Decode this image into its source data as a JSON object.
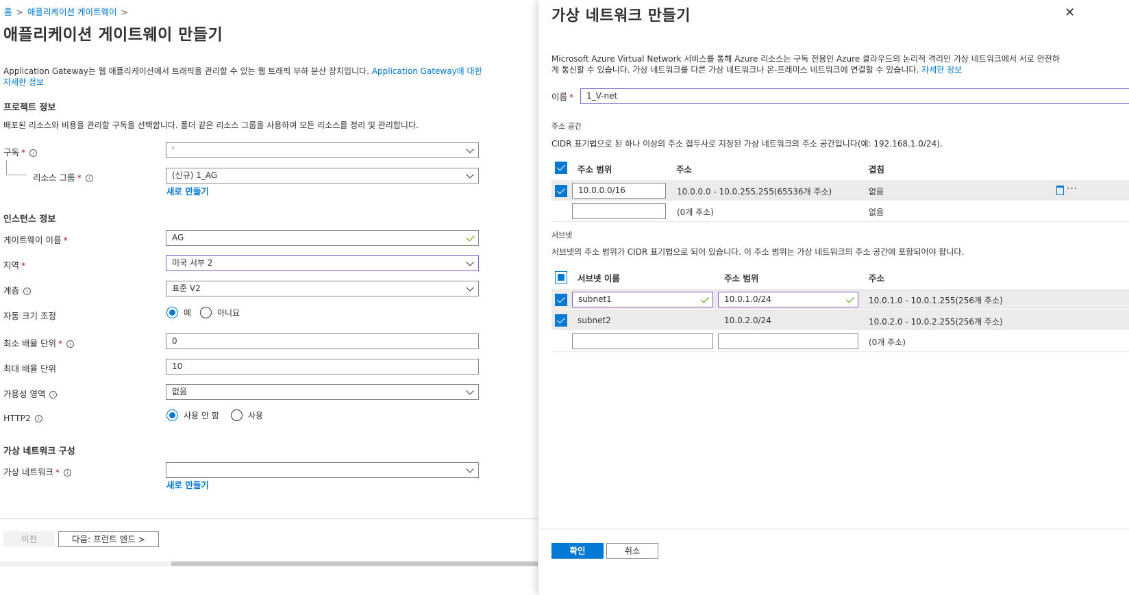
{
  "breadcrumb": {
    "home": "홈",
    "sep": ">",
    "parent": "애플리케이션 게이트웨이"
  },
  "left": {
    "title": "애플리케이션 게이트웨이 만들기",
    "description": "Application Gateway는 웹 애플리케이션에서 트래픽을 관리할 수 있는 웹 트래픽 부하 분산 장치입니다.",
    "learn_more": "Application Gateway에 대한 자세한 정보",
    "project": {
      "heading": "프로젝트 정보",
      "description": "배포된 리소스와 비용을 관리할 구독을 선택합니다. 폴더 같은 리소스 그룹을 사용하여 모든 리소스를 정리 및 관리합니다.",
      "subscription_label": "구독",
      "subscription_value": "'",
      "resource_group_label": "리소스 그룹",
      "resource_group_value": "(신규) 1_AG",
      "create_new": "새로 만들기"
    },
    "instance": {
      "heading": "인스턴스 정보",
      "gateway_name_label": "게이트웨이 이름",
      "gateway_name_value": "AG",
      "region_label": "지역",
      "region_value": "미국 서부 2",
      "tier_label": "계층",
      "tier_value": "표준 V2",
      "autoscale_label": "자동 크기 조정",
      "autoscale_yes": "예",
      "autoscale_no": "아니요",
      "min_units_label": "최소 배율 단위",
      "min_units_value": "0",
      "max_units_label": "최대 배율 단위",
      "max_units_value": "10",
      "zone_label": "가용성 영역",
      "zone_value": "없음",
      "http2_label": "HTTP2",
      "http2_disabled": "사용 안 함",
      "http2_enabled": "사용"
    },
    "vnet": {
      "heading": "가상 네트워크 구성",
      "vnet_label": "가상 네트워크",
      "vnet_value": "",
      "create_new": "새로 만들기"
    },
    "footer": {
      "prev": "이전",
      "next": "다음: 프런트 엔드 >"
    },
    "required_mark": "*",
    "info_glyph": "i"
  },
  "panel": {
    "title": "가상 네트워크 만들기",
    "close_glyph": "✕",
    "description_line1": "Microsoft Azure Virtual Network 서비스를 통해 Azure 리소스는 구독 전용인 Azure 클라우드의 논리적 격리인 가상 네트워크에서 서로 안전하",
    "description_line2": "게 통신할 수 있습니다. 가상 네트워크를 다른 가상 네트워크나 온-프레미스 네트워크에 연결할 수 있습니다.",
    "learn_more": "자세한 정보",
    "name_label": "이름",
    "name_value": "1_V-net",
    "address_space": {
      "heading": "주소 공간",
      "description": "CIDR 표기법으로 된 하나 이상의 주소 접두사로 지정된 가상 네트워크의 주소 공간입니다(예: 192.168.1.0/24).",
      "columns": [
        "주소 범위",
        "주소",
        "겹침"
      ],
      "rows": [
        {
          "range": "10.0.0.0/16",
          "addresses": "10.0.0.0 - 10.0.255.255(65536개 주소)",
          "overlap": "없음"
        },
        {
          "range": "",
          "addresses": "(0개 주소)",
          "overlap": "없음"
        }
      ]
    },
    "subnets": {
      "heading": "서브넷",
      "description": "서브넷의 주소 범위가 CIDR 표기법으로 되어 있습니다. 이 주소 범위는 가상 네트워크의 주소 공간에 포함되어야 합니다.",
      "columns": [
        "서브넷 이름",
        "주소 범위",
        "주소"
      ],
      "rows": [
        {
          "name": "subnet1",
          "range": "10.0.1.0/24",
          "addresses": "10.0.1.0 - 10.0.1.255(256개 주소)"
        },
        {
          "name": "subnet2",
          "range": "10.0.2.0/24",
          "addresses": "10.0.2.0 - 10.0.2.255(256개 주소)"
        },
        {
          "name": "",
          "range": "",
          "addresses": "(0개 주소)"
        }
      ]
    },
    "more_glyph": "···",
    "ok": "확인",
    "cancel": "취소"
  },
  "colors": {
    "accent": "#0078d4",
    "required": "#a4262c",
    "focus_border": "#8661c5",
    "valid_check": "#57a300"
  }
}
